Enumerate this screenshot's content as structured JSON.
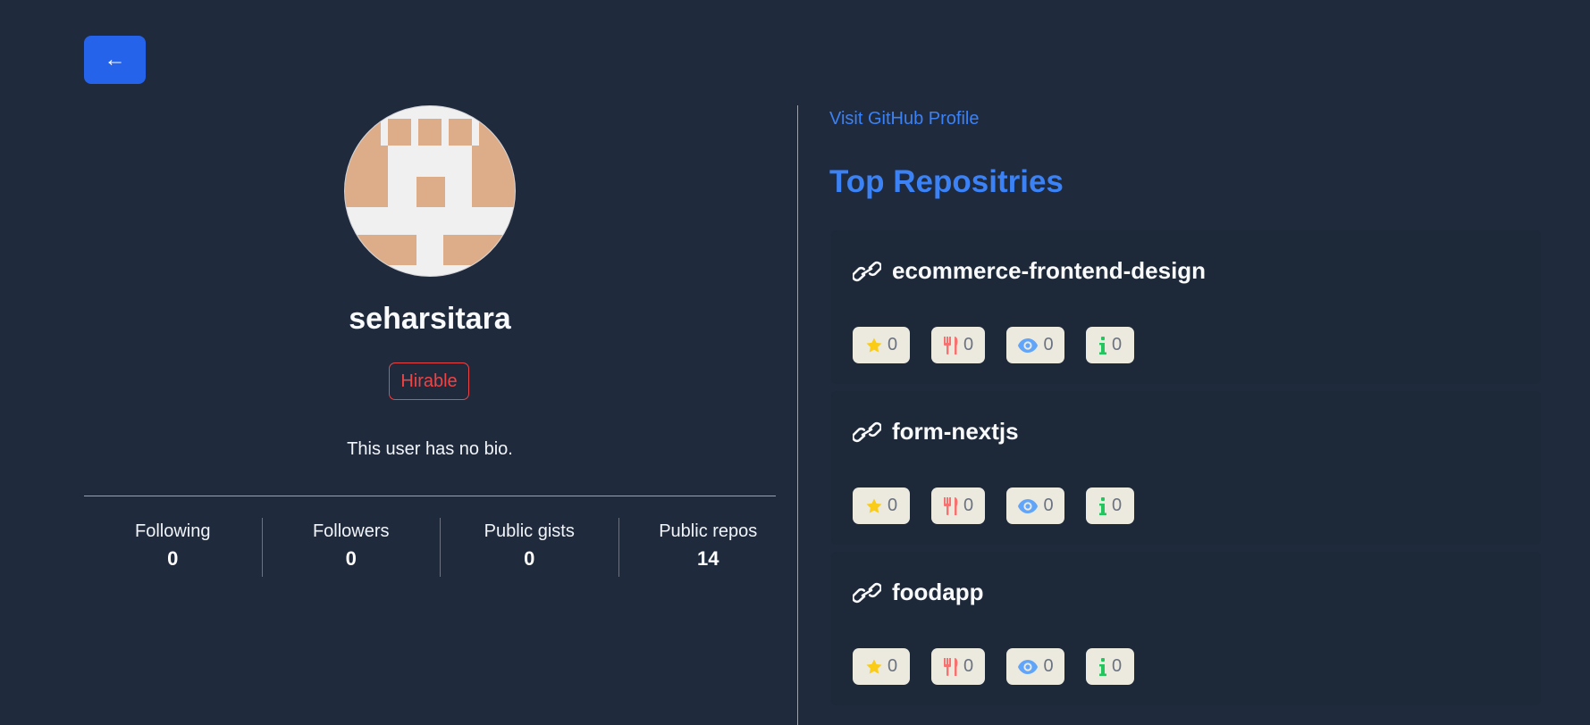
{
  "back_button": {
    "label": "←"
  },
  "profile": {
    "username": "seharsitara",
    "hirable_label": "Hirable",
    "bio": "This user has no bio.",
    "stats": [
      {
        "label": "Following",
        "value": "0"
      },
      {
        "label": "Followers",
        "value": "0"
      },
      {
        "label": "Public gists",
        "value": "0"
      },
      {
        "label": "Public repos",
        "value": "14"
      }
    ]
  },
  "right": {
    "github_link": "Visit GitHub Profile",
    "section_title": "Top Repositries"
  },
  "repos": [
    {
      "name": "ecommerce-frontend-design",
      "stars": "0",
      "forks": "0",
      "watchers": "0",
      "issues": "0"
    },
    {
      "name": "form-nextjs",
      "stars": "0",
      "forks": "0",
      "watchers": "0",
      "issues": "0"
    },
    {
      "name": "foodapp",
      "stars": "0",
      "forks": "0",
      "watchers": "0",
      "issues": "0"
    }
  ],
  "colors": {
    "background": "#1f2a3d",
    "accent": "#2563eb",
    "link": "#3b82f6",
    "hirable": "#ef4444",
    "star": "#facc15",
    "fork": "#f87171",
    "eye": "#60a5fa",
    "info": "#22c55e"
  },
  "icons": {
    "repo_link": "link-icon",
    "star": "star-icon",
    "fork": "utensils-icon",
    "watchers": "eye-icon",
    "issues": "info-icon"
  }
}
